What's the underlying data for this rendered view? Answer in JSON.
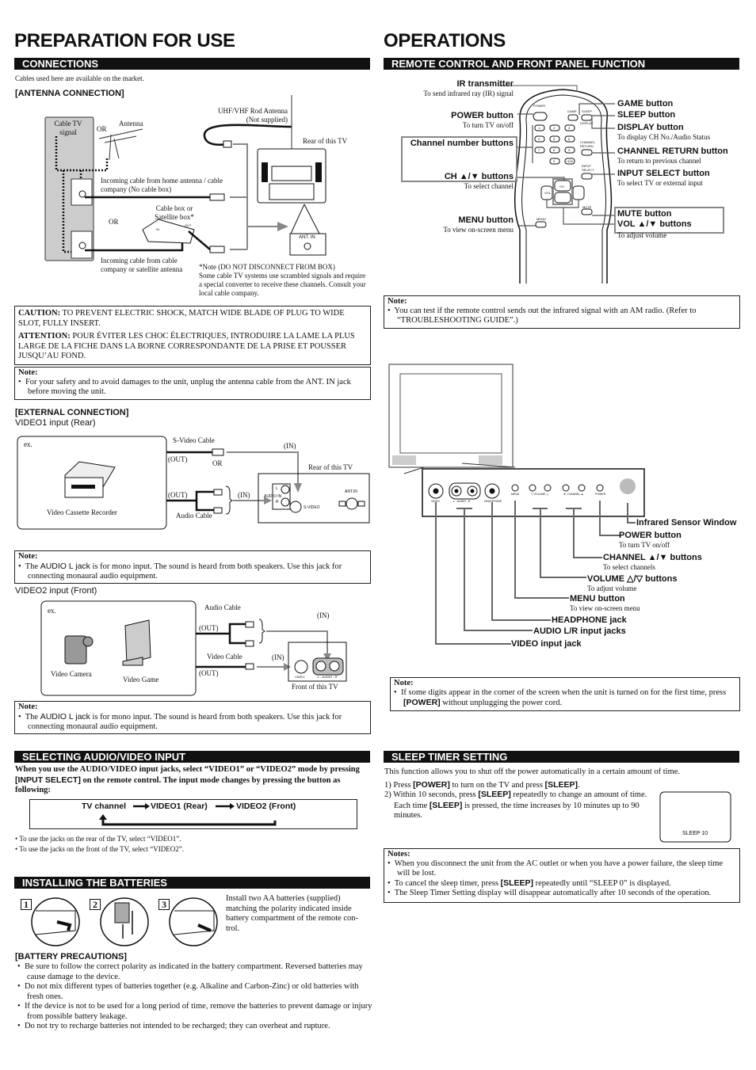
{
  "left": {
    "title": "PREPARATION FOR USE",
    "connections": {
      "header": "CONNECTIONS",
      "intro": "Cables used here are available on the market.",
      "antenna_heading": "[ANTENNA CONNECTION]",
      "diagram": {
        "cable_tv_signal": "Cable TV signal",
        "or1": "OR",
        "antenna": "Antenna",
        "rod_antenna": "UHF/VHF Rod Antenna",
        "not_supplied": "(Not supplied)",
        "rear_tv": "Rear of this TV",
        "incoming_home": "Incoming cable from home antenna / cable company (No cable box)",
        "cable_box": "Cable box or Satellite box*",
        "or2": "OR",
        "ant_in": "ANT. IN",
        "incoming_company": "Incoming cable from cable company or satellite antenna",
        "box_in": "IN",
        "box_out": "OUT",
        "note_title": "*Note (DO NOT DISCONNECT FROM BOX)",
        "note_body": "Some cable TV systems use scrambled signals and require a special converter to receive these channels. Consult your local cable company."
      },
      "caution": {
        "label": "CAUTION:",
        "text": " TO PREVENT ELECTRIC SHOCK, MATCH WIDE BLADE OF PLUG TO WIDE SLOT, FULLY INSERT.",
        "attention_label": "ATTENTION:",
        "attention_text": " POUR ÉVITER LES CHOC ÉLECTRIQUES, INTRODUIRE LA LAME LA PLUS LARGE DE LA FICHE DANS LA BORNE CORRESPONDANTE DE LA PRISE ET POUSSER JUSQU’AU FOND."
      },
      "note1": {
        "title": "Note:",
        "text": "For your safety and to avoid damages to the unit, unplug the antenna cable from the ANT. IN jack before moving the unit."
      },
      "external_heading": "[EXTERNAL CONNECTION]",
      "video1_heading": "VIDEO1 input (Rear)",
      "video1": {
        "ex": "ex.",
        "device": "Video Cassette Recorder",
        "svideo_cable": "S-Video Cable",
        "out1": "(OUT)",
        "or": "OR",
        "in1": "(IN)",
        "rear_tv": "Rear of this TV",
        "out2": "(OUT)",
        "in2": "(IN)",
        "audio_cable": "Audio Cable",
        "audio_in": "AUDIO IN",
        "l": "L",
        "r": "R",
        "svideo": "S-VIDEO",
        "ant_in": "ANT.IN"
      },
      "note2": {
        "title": "Note:",
        "pre": "The ",
        "key": "AUDIO L jack",
        "post": " is for mono input. The sound is heard from both speakers. Use this jack for connecting monaural audio equipment."
      },
      "video2_heading": "VIDEO2 input (Front)",
      "video2": {
        "ex": "ex.",
        "camera": "Video Camera",
        "game": "Video Game",
        "audio_cable": "Audio Cable",
        "out1": "(OUT)",
        "in1": "(IN)",
        "video_cable": "Video Cable",
        "in2": "(IN)",
        "out2": "(OUT)",
        "front_tv": "Front of this TV",
        "video": "VIDEO",
        "audio": "L - AUDIO - R"
      },
      "note3": {
        "title": "Note:",
        "pre": "The ",
        "key": "AUDIO L jack",
        "post": " is for mono input. The sound is heard from both speakers. Use this jack for connecting monaural audio equipment."
      }
    },
    "selecting": {
      "header": "SELECTING AUDIO/VIDEO INPUT",
      "p1": "When you use the AUDIO/VIDEO input jacks, select “VIDEO1” or “VIDEO2” mode by pressing ",
      "p_key": "[INPUT SELECT]",
      "p2": " on the remote control. The input mode changes by pressing the button as following:",
      "flow": [
        "TV channel",
        "VIDEO1 (Rear)",
        "VIDEO2 (Front)"
      ],
      "bullets": [
        "• To use the jacks on the rear of the TV, select “VIDEO1”.",
        "• To use the jacks on the front of the TV, select “VIDEO2”."
      ]
    },
    "batteries": {
      "header": "INSTALLING THE BATTERIES",
      "steps": [
        "1",
        "2",
        "3"
      ],
      "text": "Install two AA batteries (supplied) matching the polarity indicated inside battery compartment of the remote con-trol.",
      "precautions_heading": "[BATTERY PRECAUTIONS]",
      "precautions": [
        "Be sure to follow the correct polarity as indicated in the battery compartment. Reversed batteries may cause damage to the device.",
        "Do not mix different types of batteries together (e.g. Alkaline and Carbon-Zinc) or old batteries with fresh ones.",
        "If the device is not to be used for a long period of time, remove the batteries to prevent damage or injury from possible battery leakage.",
        "Do not try to recharge batteries not intended to be recharged; they can overheat and rupture."
      ]
    }
  },
  "right": {
    "title": "OPERATIONS",
    "remote": {
      "header": "REMOTE CONTROL AND FRONT PANEL FUNCTION",
      "ir_title": "IR transmitter",
      "ir_desc": "To send infrared ray (IR) signal",
      "power_title": "POWER button",
      "power_desc": "To turn TV on/off",
      "channel_numbers": "Channel number buttons",
      "ch_title": "CH ▲/▼ buttons",
      "ch_desc": "To select channel",
      "menu_title": "MENU button",
      "menu_desc": "To view on-screen menu",
      "game_title": "GAME button",
      "sleep_title": "SLEEP button",
      "display_title": "DISPLAY button",
      "display_desc": "To display CH No./Audio Status",
      "return_title": "CHANNEL RETURN button",
      "return_desc": "To return to previous channel",
      "input_title": "INPUT SELECT button",
      "input_desc": "To select TV or external input",
      "mute_title": "MUTE button",
      "vol_title": "VOL ▲/▼ buttons",
      "vol_desc": "To adjust volume",
      "remote_labels": {
        "power": "POWER",
        "game": "GAME",
        "sleep": "SLEEP",
        "display": "DISPLAY",
        "channel_return": "CHANNEL RETURN",
        "input_select": "INPUT SELECT",
        "ch": "CH",
        "vol": "VOL",
        "mute": "MUTE",
        "menu": "MENU",
        "digits": [
          "1",
          "2",
          "3",
          "4",
          "5",
          "6",
          "7",
          "8",
          "9",
          "0",
          "+100"
        ]
      }
    },
    "note_remote": {
      "title": "Note:",
      "text": "You can test if the remote control sends out the infrared signal with an AM radio. (Refer to “TROUBLESHOOTING GUIDE”.)"
    },
    "front_panel": {
      "panel_labels": {
        "video": "VIDEO",
        "audio": "L - AUDIO - R",
        "headphone": "HEADPHONE",
        "menu": "MENU",
        "volume": "▽ VOLUME △",
        "channel": "▼ CHANNEL ▲",
        "power": "POWER"
      },
      "infrared": "Infrared Sensor Window",
      "power_title": "POWER button",
      "power_desc": "To turn TV on/off",
      "channel_title": "CHANNEL ▲/▼ buttons",
      "channel_desc": "To select channels",
      "volume_title": "VOLUME △/▽ buttons",
      "volume_desc": "To adjust volume",
      "menu_title": "MENU button",
      "menu_desc": "To view on-screen menu",
      "headphone": "HEADPHONE jack",
      "audio": "AUDIO L/R input jacks",
      "video": "VIDEO input jack"
    },
    "note_power": {
      "title": "Note:",
      "pre": "If some digits appear in the corner of the screen when the unit is turned on for the first time, press ",
      "key": "[POWER]",
      "post": " without unplugging the power cord."
    },
    "sleep": {
      "header": "SLEEP TIMER SETTING",
      "intro": "This function allows you to shut off the power automatically in a certain amount of time.",
      "s1a": "1) Press ",
      "s1k1": "[POWER]",
      "s1b": " to turn on the TV and press ",
      "s1k2": "[SLEEP]",
      "s1c": ".",
      "s2a": "2) Within 10 seconds, press ",
      "s2k1": "[SLEEP]",
      "s2b": " repeatedly to change an amount of time. Each time ",
      "s2k2": "[SLEEP]",
      "s2c": " is pressed, the time increases by 10 minutes up to 90 minutes.",
      "screen_text": "SLEEP 10",
      "notes_title": "Notes:",
      "n1": "When you disconnect the unit from the AC outlet or when you have a power failure, the sleep time will be lost.",
      "n2a": "To cancel the sleep timer, press ",
      "n2k": "[SLEEP]",
      "n2b": " repeatedly until “SLEEP 0” is displayed.",
      "n3": "The Sleep Timer Setting display will disappear automatically after 10 seconds of the operation."
    }
  }
}
